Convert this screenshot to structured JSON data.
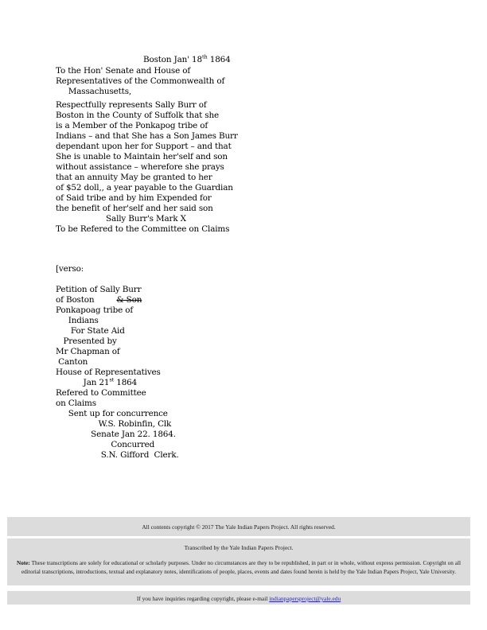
{
  "document": {
    "type": "historical-transcription",
    "recto": {
      "heading_line": "Boston Jan' 18",
      "heading_sup": "th",
      "heading_year": " 1864",
      "lines": [
        "To the Hon' Senate and House of",
        "Representatives of the Commonwealth of",
        "     Massachusetts,",
        "Respectfully represents Sally Burr of",
        "Boston in the County of Suffolk that she",
        "is a Member of the Ponkapog tribe of",
        "Indians – and that She has a Son James Burr",
        "dependant upon her for Support – and that",
        "She is unable to Maintain her'self and son",
        "without assistance – wherefore she prays",
        "that an annuity May be granted to her",
        "of $52 doll,, a year payable to the Guardian",
        "of Said tribe and by him Expended for",
        "the benefit of her'self and her said son",
        "                    Sally Burr's Mark X",
        "To be Refered to the Committee on Claims"
      ]
    },
    "verso": {
      "marker": "[verso:",
      "petition_line": "Petition of Sally Burr",
      "of_boston": "of Boston",
      "struck_text": "& Son",
      "lines_after": [
        "Ponkapoag tribe of",
        "     Indians",
        "      For State Aid",
        "   Presented by",
        "Mr Chapman of",
        " Canton",
        "House of Representatives"
      ],
      "date_line_prefix": "           Jan 21",
      "date_line_sup": "st",
      "date_line_suffix": " 1864",
      "lines_tail": [
        "Refered to Committee",
        "on Claims",
        "     Sent up for concurrence",
        "                 W.S. Robinfin, Clk",
        "              Senate Jan 22. 1864.",
        "                      Concurred",
        "                  S.N. Gifford  Clerk."
      ]
    }
  },
  "footer": {
    "copyright": "All contents copyright © 2017  The Yale Indian Papers Project. All rights reserved.",
    "transcribed_by": "Transcribed by the Yale Indian Papers Project.",
    "note_label": "Note:",
    "note_body": " These transcriptions are solely for educational or scholarly purposes.  Under no circumstances are they to be republished, in part or in whole, without express permission. Copyright on all editorial transcriptions, introductions, textual and explanatory notes, identifications of people, places, events and dates found herein is held by the Yale Indian Papers Project, Yale University.",
    "inquiries_prefix": "If you have inquiries regarding copyright, please e-mail ",
    "email": "indianpapersproject@yale.edu",
    "band_color": "#dcdcdc",
    "link_color": "#2020d0"
  }
}
